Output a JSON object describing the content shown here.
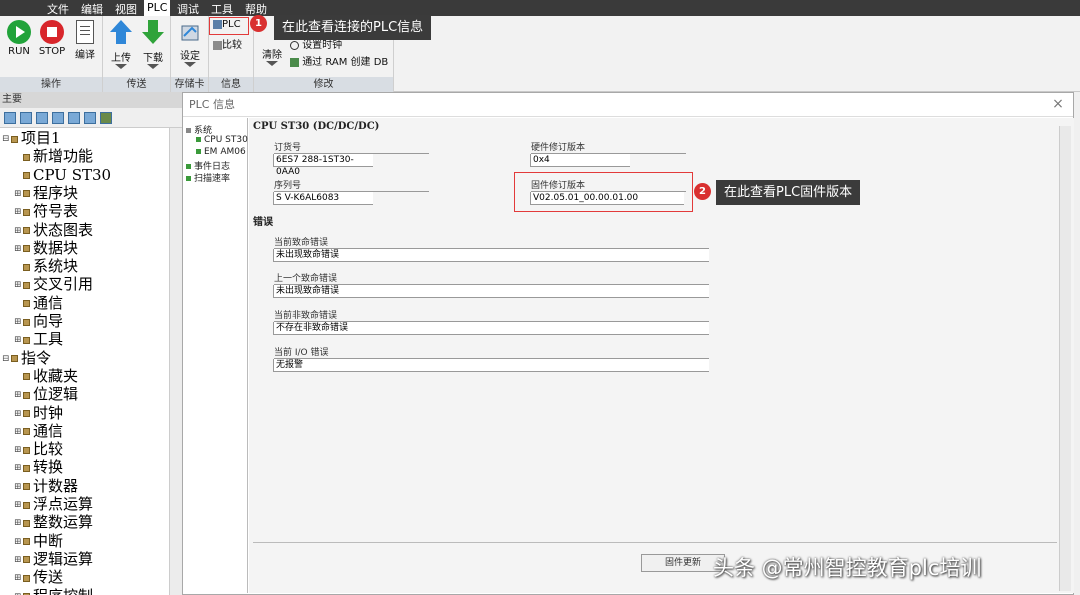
{
  "menu": {
    "items": [
      "文件",
      "编辑",
      "视图",
      "PLC",
      "调试",
      "工具",
      "帮助"
    ],
    "active": "PLC"
  },
  "ribbon": {
    "groups": {
      "operation": "操作",
      "transfer": "传送",
      "memory_card": "存储卡",
      "info": "信息",
      "modify": "修改"
    },
    "buttons": {
      "run": "RUN",
      "stop": "STOP",
      "compile": "编译",
      "upload": "上传",
      "download": "下载",
      "settings": "设定",
      "plc": "PLC",
      "compare": "比较",
      "clear": "清除",
      "set_clock": "设置时钟",
      "create_db": "通过 RAM 创建 DB"
    }
  },
  "left_panel": {
    "header": "主要",
    "tree": [
      {
        "label": "项目1",
        "level": 0,
        "expand": "⊟"
      },
      {
        "label": "新增功能",
        "level": 1
      },
      {
        "label": "CPU ST30",
        "level": 1
      },
      {
        "label": "程序块",
        "level": 1,
        "expand": "⊞"
      },
      {
        "label": "符号表",
        "level": 1,
        "expand": "⊞"
      },
      {
        "label": "状态图表",
        "level": 1,
        "expand": "⊞"
      },
      {
        "label": "数据块",
        "level": 1,
        "expand": "⊞"
      },
      {
        "label": "系统块",
        "level": 1
      },
      {
        "label": "交叉引用",
        "level": 1,
        "expand": "⊞"
      },
      {
        "label": "通信",
        "level": 1
      },
      {
        "label": "向导",
        "level": 1,
        "expand": "⊞"
      },
      {
        "label": "工具",
        "level": 1,
        "expand": "⊞"
      },
      {
        "label": "指令",
        "level": 0,
        "expand": "⊟"
      },
      {
        "label": "收藏夹",
        "level": 1
      },
      {
        "label": "位逻辑",
        "level": 1,
        "expand": "⊞"
      },
      {
        "label": "时钟",
        "level": 1,
        "expand": "⊞"
      },
      {
        "label": "通信",
        "level": 1,
        "expand": "⊞"
      },
      {
        "label": "比较",
        "level": 1,
        "expand": "⊞"
      },
      {
        "label": "转换",
        "level": 1,
        "expand": "⊞"
      },
      {
        "label": "计数器",
        "level": 1,
        "expand": "⊞"
      },
      {
        "label": "浮点运算",
        "level": 1,
        "expand": "⊞"
      },
      {
        "label": "整数运算",
        "level": 1,
        "expand": "⊞"
      },
      {
        "label": "中断",
        "level": 1,
        "expand": "⊞"
      },
      {
        "label": "逻辑运算",
        "level": 1,
        "expand": "⊞"
      },
      {
        "label": "传送",
        "level": 1,
        "expand": "⊞"
      },
      {
        "label": "程序控制",
        "level": 1,
        "expand": "⊞"
      }
    ]
  },
  "dialog": {
    "title": "PLC 信息",
    "nav": [
      "系统",
      "CPU ST30",
      "EM AM06",
      "事件日志",
      "扫描速率"
    ],
    "cpu_heading": "CPU ST30 (DC/DC/DC)",
    "order_no_label": "订货号",
    "order_no": "6ES7 288-1ST30-0AA0",
    "hw_rev_label": "硬件修订版本",
    "hw_rev": "0x4",
    "serial_label": "序列号",
    "serial": "S V-K6AL6083",
    "fw_rev_label": "固件修订版本",
    "fw_rev": "V02.05.01_00.00.01.00",
    "errors_heading": "错误",
    "cur_fatal_label": "当前致命错误",
    "cur_fatal": "未出现致命错误",
    "prev_fatal_label": "上一个致命错误",
    "prev_fatal": "未出现致命错误",
    "cur_nonfatal_label": "当前非致命错误",
    "cur_nonfatal": "不存在非致命错误",
    "cur_io_label": "当前 I/O 错误",
    "cur_io": "无报警",
    "fw_update_button": "固件更新"
  },
  "callouts": {
    "c1_num": "1",
    "c1_text": "在此查看连接的PLC信息",
    "c2_num": "2",
    "c2_text": "在此查看PLC固件版本"
  },
  "watermark": "头条 @常州智控教育plc培训",
  "colors": {
    "run": "#21a33a",
    "stop": "#d8262b",
    "arrow": "#2f87d8",
    "callout_bg": "#3b3b3b",
    "badge": "#d93030"
  }
}
